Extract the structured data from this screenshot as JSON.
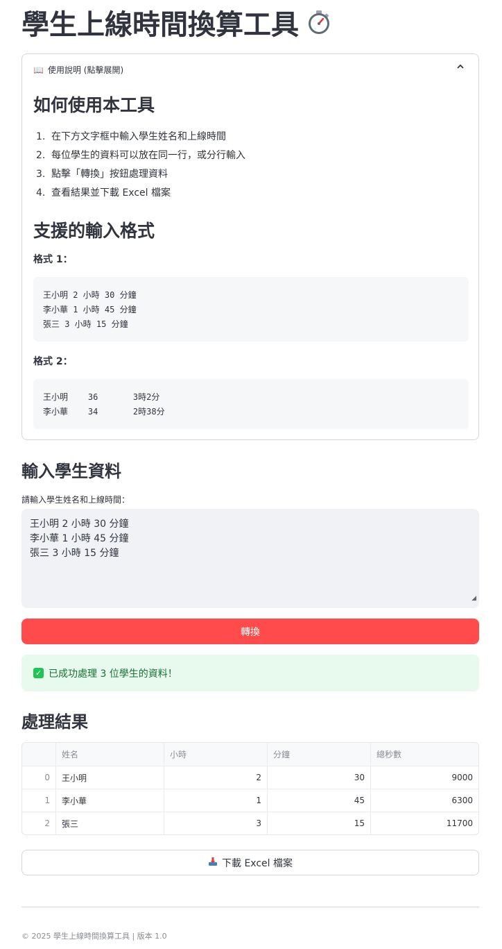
{
  "page": {
    "title": "學生上線時間換算工具",
    "title_icon": "stopwatch-icon"
  },
  "instructions": {
    "header_icon": "open-book-icon",
    "header_label": "使用說明 (點擊展開)",
    "how_to_title": "如何使用本工具",
    "steps": [
      {
        "num": "1.",
        "text": "在下方文字框中輸入學生姓名和上線時間"
      },
      {
        "num": "2.",
        "text": "每位學生的資料可以放在同一行，或分行輸入"
      },
      {
        "num": "3.",
        "text": "點擊「轉換」按鈕處理資料"
      },
      {
        "num": "4.",
        "text": "查看結果並下載 Excel 檔案"
      }
    ],
    "formats_title": "支援的輸入格式",
    "format1_label": "格式 1：",
    "format1_lines": [
      "王小明 2 小時 30 分鐘",
      "李小華 1 小時 45 分鐘",
      "張三 3 小時 15 分鐘"
    ],
    "format2_label": "格式 2：",
    "format2_lines": [
      "王小明    36       3時2分",
      "李小華    34       2時38分"
    ]
  },
  "input": {
    "section_title": "輸入學生資料",
    "label": "請輸入學生姓名和上線時間：",
    "value_lines": [
      "王小明 2 小時 30 分鐘",
      "李小華 1 小時 45 分鐘",
      "張三 3 小時 15 分鐘"
    ]
  },
  "convert_button": "轉換",
  "success_message": "已成功處理 3 位學生的資料！",
  "results": {
    "section_title": "處理結果",
    "columns": [
      "",
      "姓名",
      "小時",
      "分鐘",
      "總秒數"
    ],
    "rows": [
      {
        "idx": "0",
        "name": "王小明",
        "hours": "2",
        "minutes": "30",
        "seconds": "9000"
      },
      {
        "idx": "1",
        "name": "李小華",
        "hours": "1",
        "minutes": "45",
        "seconds": "6300"
      },
      {
        "idx": "2",
        "name": "張三",
        "hours": "3",
        "minutes": "15",
        "seconds": "11700"
      }
    ]
  },
  "download_button": {
    "icon": "inbox-tray-icon",
    "label": "下載 Excel 檔案"
  },
  "footer": "© 2025 學生上線時間換算工具 | 版本 1.0",
  "colors": {
    "primary": "#ff4b4b",
    "success_bg": "#e8f9ee",
    "success_text": "#177233",
    "input_bg": "#f0f2f6"
  }
}
